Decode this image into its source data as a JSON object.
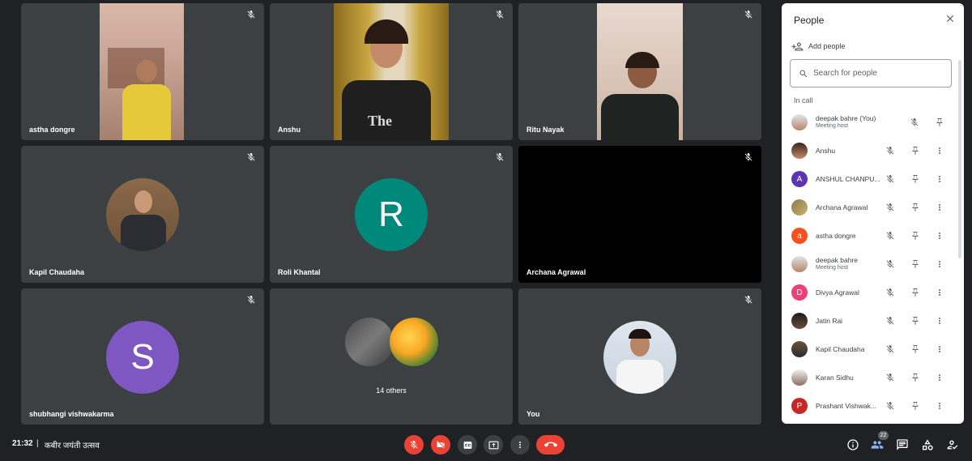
{
  "tiles": [
    {
      "name": "astha dongre"
    },
    {
      "name": "Anshu"
    },
    {
      "name": "Ritu Nayak"
    },
    {
      "name": "Kapil Chaudaha"
    },
    {
      "name": "Roli Khantal",
      "letter": "R"
    },
    {
      "name": "Archana Agrawal"
    },
    {
      "name": "shubhangi vishwakarma",
      "letter": "S"
    },
    {
      "others": "14 others"
    },
    {
      "name": "You"
    }
  ],
  "people_panel": {
    "title": "People",
    "add_people": "Add people",
    "search_placeholder": "Search for people",
    "section": "In call",
    "participants": [
      {
        "name": "deepak bahre (You)",
        "sub": "Meeting host"
      },
      {
        "name": "Anshu"
      },
      {
        "name": "ANSHUL CHANPU...",
        "letter": "A",
        "color": "#5e35b1"
      },
      {
        "name": "Archana Agrawal"
      },
      {
        "name": "astha dongre",
        "letter": "a",
        "color": "#f4511e"
      },
      {
        "name": "deepak bahre",
        "sub": "Meeting host"
      },
      {
        "name": "Divya Agrawal",
        "letter": "D",
        "color": "#ec407a"
      },
      {
        "name": "Jatin Rai"
      },
      {
        "name": "Kapil Chaudaha"
      },
      {
        "name": "Karan Sidhu"
      },
      {
        "name": "Prashant Vishwak...",
        "letter": "P",
        "color": "#c62828"
      }
    ]
  },
  "bottom_bar": {
    "time": "21:32",
    "separator": "|",
    "meeting_title": "कबीर जयंती उत्सव",
    "participants_count": "22"
  },
  "colors": {
    "background": "#202124",
    "tile": "#3c4043",
    "red": "#ea4335",
    "roli_avatar": "#00897b",
    "shubhangi_avatar": "#7e57c2"
  }
}
